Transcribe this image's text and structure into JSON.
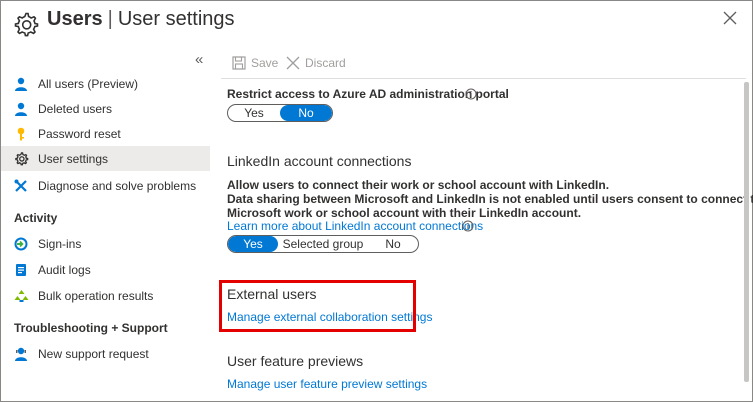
{
  "header": {
    "title_main": "Users",
    "separator": "|",
    "title_sub": "User settings"
  },
  "sidebar": {
    "collapse_glyph": "«",
    "items": [
      {
        "label": "All users (Preview)",
        "icon": "user-icon"
      },
      {
        "label": "Deleted users",
        "icon": "user-icon"
      },
      {
        "label": "Password reset",
        "icon": "key-icon"
      },
      {
        "label": "User settings",
        "icon": "gear-icon",
        "selected": true
      },
      {
        "label": "Diagnose and solve problems",
        "icon": "wrench-icon"
      }
    ],
    "activity_title": "Activity",
    "activity_items": [
      {
        "label": "Sign-ins",
        "icon": "sign-ins-icon"
      },
      {
        "label": "Audit logs",
        "icon": "audit-logs-icon"
      },
      {
        "label": "Bulk operation results",
        "icon": "bulk-operation-icon"
      }
    ],
    "support_title": "Troubleshooting + Support",
    "support_items": [
      {
        "label": "New support request",
        "icon": "support-person-icon"
      }
    ]
  },
  "toolbar": {
    "save_label": "Save",
    "discard_label": "Discard"
  },
  "admin_portal": {
    "label": "Restrict access to Azure AD administration portal",
    "options": [
      "Yes",
      "No"
    ],
    "selected": "No"
  },
  "linkedin": {
    "heading": "LinkedIn account connections",
    "description_line1": "Allow users to connect their work or school account with LinkedIn.",
    "description_line2": "Data sharing between Microsoft and LinkedIn is not enabled until users consent to connect their",
    "description_line3": "Microsoft work or school account with their LinkedIn account.",
    "learn_more_link": "Learn more about LinkedIn account connections",
    "options": [
      "Yes",
      "Selected group",
      "No"
    ],
    "selected": "Yes"
  },
  "external_users": {
    "heading": "External users",
    "link": "Manage external collaboration settings"
  },
  "previews": {
    "heading": "User feature previews",
    "link": "Manage user feature preview settings"
  },
  "colors": {
    "accent": "#0078d4",
    "highlight": "#e50000",
    "selected_bg": "#edebe9"
  }
}
